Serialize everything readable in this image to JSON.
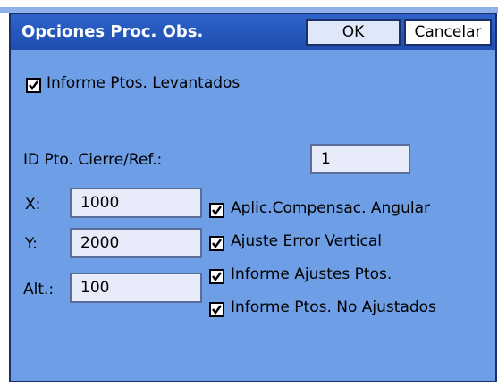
{
  "dialog": {
    "title": "Opciones Proc. Obs.",
    "ok_label": "OK",
    "cancel_label": "Cancelar"
  },
  "options": {
    "informe_ptos_levantados": {
      "label": "Informe Ptos. Levantados",
      "checked": true
    },
    "aplic_compensac": {
      "label": "Aplic.Compensac. Angular",
      "checked": true
    },
    "ajuste_error_vertical": {
      "label": "Ajuste Error Vertical",
      "checked": true
    },
    "informe_ajustes": {
      "label": "Informe Ajustes Ptos.",
      "checked": true
    },
    "informe_no_ajustados": {
      "label": "Informe Ptos. No Ajustados",
      "checked": true
    }
  },
  "fields": {
    "id_label": "ID Pto. Cierre/Ref.:",
    "id_value": "1",
    "x_label": "X:",
    "x_value": "1000",
    "y_label": "Y:",
    "y_value": "2000",
    "alt_label": "Alt.:",
    "alt_value": "100"
  },
  "colors": {
    "dialog_bg": "#6e9ee6",
    "titlebar": "#2e63c9",
    "field_bg": "#e8ecfa"
  }
}
